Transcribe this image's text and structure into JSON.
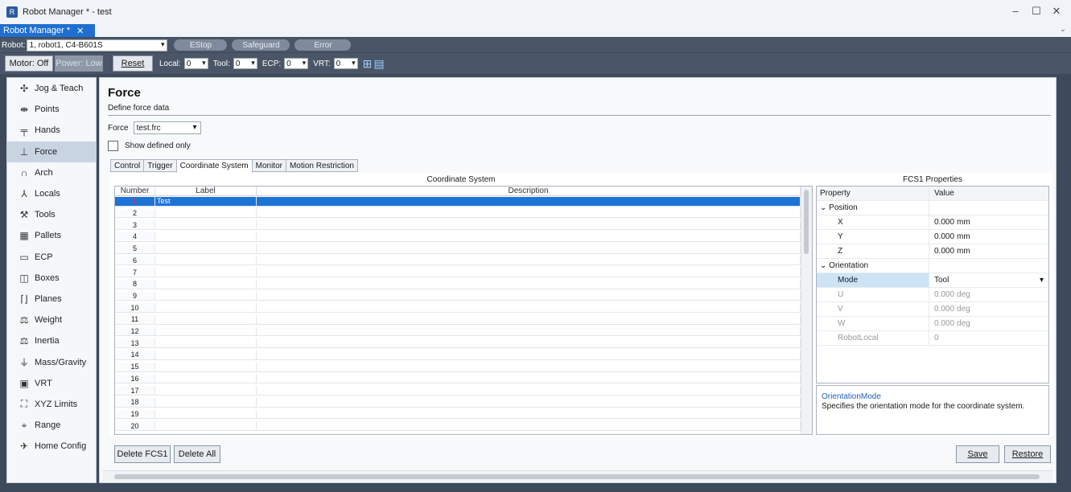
{
  "window": {
    "title": "Robot Manager * - test",
    "tab_label": "Robot Manager *",
    "tab_close": "✕"
  },
  "toolbar": {
    "robot_label": "Robot:",
    "robot_value": "1, robot1, C4-B601S",
    "estop": "EStop",
    "safeguard": "Safeguard",
    "error": "Error",
    "motor": "Motor: Off",
    "power": "Power: Low",
    "reset": "Reset",
    "local_label": "Local:",
    "local_value": "0",
    "tool_label": "Tool:",
    "tool_value": "0",
    "ecp_label": "ECP:",
    "ecp_value": "0",
    "vrt_label": "VRT:",
    "vrt_value": "0"
  },
  "sidebar": {
    "items": [
      {
        "label": "Jog & Teach",
        "icon": "jog-icon",
        "glyph": "✣"
      },
      {
        "label": "Points",
        "icon": "points-icon",
        "glyph": "⇼"
      },
      {
        "label": "Hands",
        "icon": "hands-icon",
        "glyph": "╤"
      },
      {
        "label": "Force",
        "icon": "force-icon",
        "glyph": "⊥"
      },
      {
        "label": "Arch",
        "icon": "arch-icon",
        "glyph": "∩"
      },
      {
        "label": "Locals",
        "icon": "locals-icon",
        "glyph": "⅄"
      },
      {
        "label": "Tools",
        "icon": "tools-icon",
        "glyph": "⚒"
      },
      {
        "label": "Pallets",
        "icon": "pallets-icon",
        "glyph": "▦"
      },
      {
        "label": "ECP",
        "icon": "ecp-icon",
        "glyph": "▭"
      },
      {
        "label": "Boxes",
        "icon": "boxes-icon",
        "glyph": "◫"
      },
      {
        "label": "Planes",
        "icon": "planes-icon",
        "glyph": "⌈⌋"
      },
      {
        "label": "Weight",
        "icon": "weight-icon",
        "glyph": "⚖"
      },
      {
        "label": "Inertia",
        "icon": "inertia-icon",
        "glyph": "⚖"
      },
      {
        "label": "Mass/Gravity",
        "icon": "mass-gravity-icon",
        "glyph": "⏚"
      },
      {
        "label": "VRT",
        "icon": "vrt-icon",
        "glyph": "▣"
      },
      {
        "label": "XYZ Limits",
        "icon": "xyz-limits-icon",
        "glyph": "⛶"
      },
      {
        "label": "Range",
        "icon": "range-icon",
        "glyph": "⌖"
      },
      {
        "label": "Home Config",
        "icon": "home-config-icon",
        "glyph": "✈"
      }
    ]
  },
  "page": {
    "title": "Force",
    "subtitle": "Define force data",
    "force_label": "Force",
    "force_value": "test.frc",
    "show_defined": "Show defined only",
    "tabs": [
      "Control",
      "Trigger",
      "Coordinate System",
      "Monitor",
      "Motion Restriction"
    ]
  },
  "grid": {
    "title": "Coordinate System",
    "columns": [
      "Number",
      "Label",
      "Description"
    ],
    "rows": [
      {
        "n": "1",
        "label": "Test"
      },
      {
        "n": "2",
        "label": ""
      },
      {
        "n": "3",
        "label": ""
      },
      {
        "n": "4",
        "label": ""
      },
      {
        "n": "5",
        "label": ""
      },
      {
        "n": "6",
        "label": ""
      },
      {
        "n": "7",
        "label": ""
      },
      {
        "n": "8",
        "label": ""
      },
      {
        "n": "9",
        "label": ""
      },
      {
        "n": "10",
        "label": ""
      },
      {
        "n": "11",
        "label": ""
      },
      {
        "n": "12",
        "label": ""
      },
      {
        "n": "13",
        "label": ""
      },
      {
        "n": "14",
        "label": ""
      },
      {
        "n": "15",
        "label": ""
      },
      {
        "n": "16",
        "label": ""
      },
      {
        "n": "17",
        "label": ""
      },
      {
        "n": "18",
        "label": ""
      },
      {
        "n": "19",
        "label": ""
      },
      {
        "n": "20",
        "label": ""
      }
    ]
  },
  "props": {
    "title": "FCS1 Properties",
    "col_property": "Property",
    "col_value": "Value",
    "position": "Position",
    "x": "X",
    "x_val": "0.000",
    "y": "Y",
    "y_val": "0.000",
    "z": "Z",
    "z_val": "0.000",
    "unit_mm": "mm",
    "orientation": "Orientation",
    "mode": "Mode",
    "mode_val": "Tool",
    "u": "U",
    "u_val": "0.000",
    "v": "V",
    "v_val": "0.000",
    "w": "W",
    "w_val": "0.000",
    "unit_deg": "deg",
    "robotlocal": "RobotLocal",
    "robotlocal_val": "0",
    "desc_title": "OrientationMode",
    "desc_text": "Specifies the orientation mode for the coordinate system."
  },
  "buttons": {
    "delete_fcs1": "Delete FCS1",
    "delete_all": "Delete All",
    "save": "Save",
    "restore": "Restore"
  }
}
